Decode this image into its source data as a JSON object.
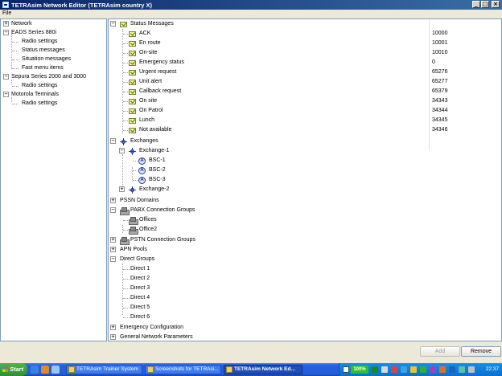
{
  "window": {
    "title": "TETRAsim Network Editor (TETRAsim country X)",
    "controls": [
      "_",
      "□",
      "×"
    ]
  },
  "menu": {
    "file": "File"
  },
  "left_tree": [
    {
      "label": "Network",
      "depth": 0,
      "expander": "+"
    },
    {
      "label": "EADS Series 880i",
      "depth": 0,
      "expander": "−"
    },
    {
      "label": "Radio settings",
      "depth": 1
    },
    {
      "label": "Status messages",
      "depth": 1
    },
    {
      "label": "Situation messages",
      "depth": 1
    },
    {
      "label": "Fast menu items",
      "depth": 1
    },
    {
      "label": "Sepura Series 2000 and 3000",
      "depth": 0,
      "expander": "−"
    },
    {
      "label": "Radio settings",
      "depth": 1
    },
    {
      "label": "Motorola Terminals",
      "depth": 0,
      "expander": "−"
    },
    {
      "label": "Radio settings",
      "depth": 1
    }
  ],
  "status_messages": {
    "header": "Status Messages",
    "items": [
      {
        "label": "ACK",
        "value": "10000"
      },
      {
        "label": "En route",
        "value": "10001"
      },
      {
        "label": "On-site",
        "value": "10010"
      },
      {
        "label": "Emergency status",
        "value": "0"
      },
      {
        "label": "Urgent request",
        "value": "65276"
      },
      {
        "label": "Unit alert",
        "value": "65277"
      },
      {
        "label": "Callback request",
        "value": "65379"
      },
      {
        "label": "On site",
        "value": "34343"
      },
      {
        "label": "On Patrol",
        "value": "34344"
      },
      {
        "label": "Lunch",
        "value": "34345"
      },
      {
        "label": "Not available",
        "value": "34346"
      }
    ]
  },
  "exchanges": {
    "header": "Exchanges",
    "exchange1": "Exchange-1",
    "bscs": [
      "BSC-1",
      "BSC-2",
      "BSC-3"
    ],
    "exchange2": "Exchange-2"
  },
  "pssn_domains": "PSSN Domains",
  "pabx": {
    "header": "PABX Connection Groups",
    "items": [
      "Offices",
      "Office2"
    ]
  },
  "pstn": "PSTN Connection Groups",
  "apn_pools": "APN Pools",
  "direct_groups": {
    "header": "Direct Groups",
    "items": [
      "Direct 1",
      "Direct 2",
      "Direct 3",
      "Direct 4",
      "Direct 5",
      "Direct 6"
    ]
  },
  "emergency_config": "Emergency Configuration",
  "general_params": "General Network Parameters",
  "buttons": {
    "add": "Add",
    "remove": "Remove"
  },
  "taskbar": {
    "start": "Start",
    "tasks": [
      "TETRAsim Trainer System",
      "Screenshots for TETRAsi...",
      "TETRAsim Network Ed..."
    ],
    "battery": "100%",
    "clock": "22:37"
  },
  "colors": {
    "title_bar": "#0a246a",
    "taskbar": "#245edb",
    "tree_border": "#7f9db9"
  }
}
